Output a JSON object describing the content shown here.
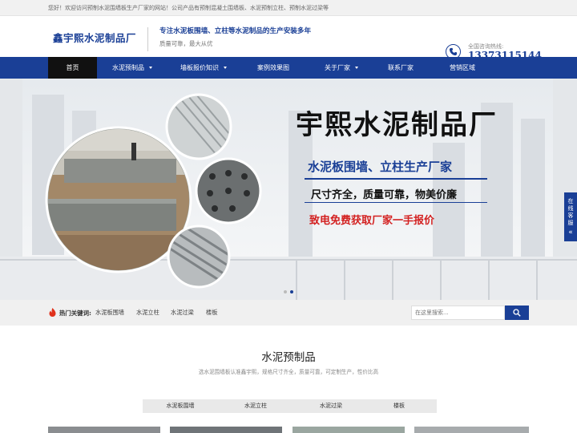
{
  "topbar": {
    "text": "您好！欢迎访问预制水泥围墙板生产厂家的网站！公司产品有预制混凝土围墙板、水泥预制立柱、预制水泥过梁等"
  },
  "header": {
    "logo": "鑫宇熙水泥制品厂",
    "slogan_main": "专注水泥板围墙、立柱等水泥制品的生产安装多年",
    "slogan_sub": "质量可靠，最大从优",
    "hotline_label": "全国咨询热线:",
    "hotline_number": "13373115144"
  },
  "nav": {
    "items": [
      {
        "label": "首页",
        "active": true,
        "dropdown": false
      },
      {
        "label": "水泥预制品",
        "active": false,
        "dropdown": true
      },
      {
        "label": "墙板报价知识",
        "active": false,
        "dropdown": true
      },
      {
        "label": "案例效果图",
        "active": false,
        "dropdown": false
      },
      {
        "label": "关于厂家",
        "active": false,
        "dropdown": true
      },
      {
        "label": "联系厂家",
        "active": false,
        "dropdown": false
      },
      {
        "label": "营销区域",
        "active": false,
        "dropdown": false
      }
    ]
  },
  "banner": {
    "title": "宇熙水泥制品厂",
    "sub1": "水泥板围墙、立柱生产厂家",
    "sub2": "尺寸齐全，质量可靠，物美价廉",
    "sub3": "致电免费获取厂家一手报价",
    "slide_count": 2,
    "active_slide": 2
  },
  "side_tab": {
    "label": "在线客服"
  },
  "keywords": {
    "label": "热门关键词:",
    "items": [
      "水泥板围墙",
      "水泥立柱",
      "水泥过梁",
      "楼板"
    ]
  },
  "search": {
    "placeholder": "在这里搜索..."
  },
  "products": {
    "title": "水泥预制品",
    "desc": "选水泥围墙板认准鑫宇熙，规格尺寸齐全，质量可靠，可定制生产，性价比高",
    "categories": [
      "水泥板围墙",
      "水泥立柱",
      "水泥过梁",
      "楼板"
    ]
  },
  "colors": {
    "brand": "#1a3f96",
    "accent_red": "#d32020",
    "nav_active": "#111111"
  }
}
